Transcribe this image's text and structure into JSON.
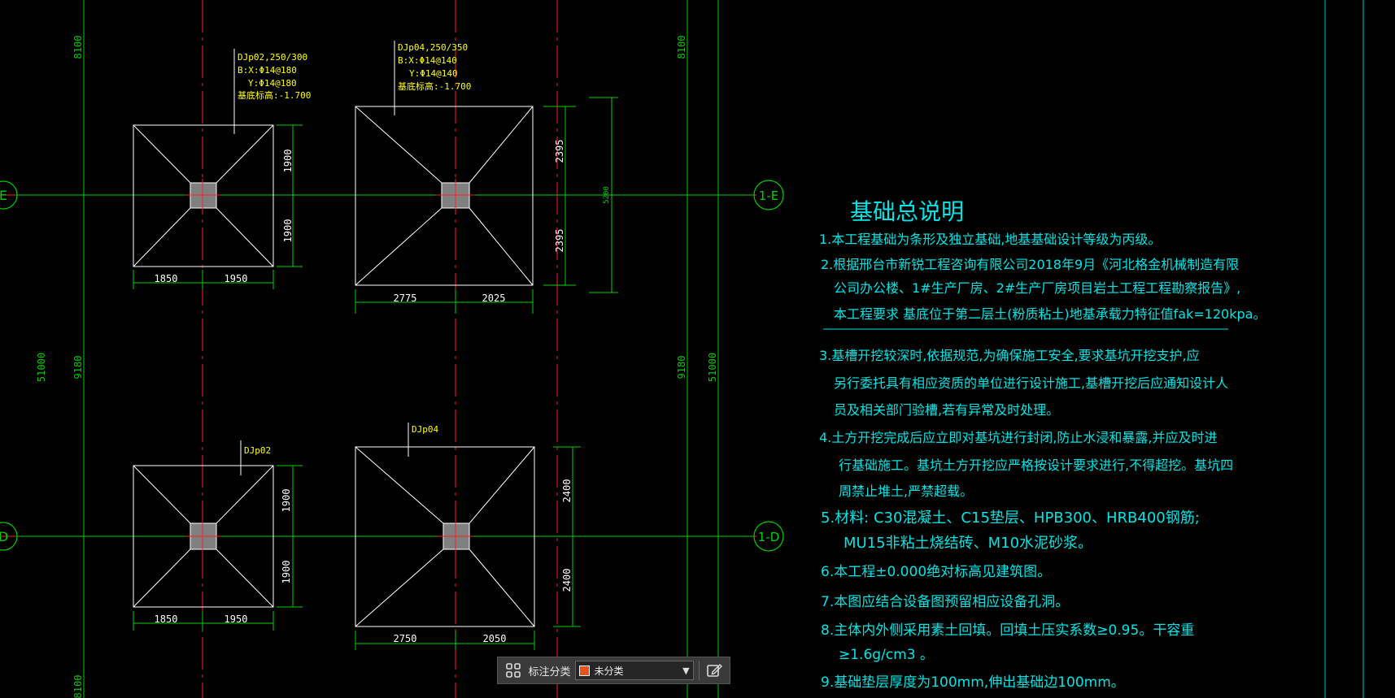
{
  "colors": {
    "background": "#000000",
    "axis": "#ff2020",
    "grid": "#00d000",
    "dim": "#00d000",
    "outline": "#ffffff",
    "label": "#ffff00",
    "note": "#00e5e5",
    "column": "#808080"
  },
  "grid_labels": {
    "e_left": "E",
    "e_right": "1-E",
    "d_left": "D",
    "d_right": "1-D"
  },
  "vertical_dims": {
    "left_top": "8100",
    "left_mid": "9180",
    "left_total": "51000",
    "left_bottom": "8100",
    "right_top": "8100",
    "right_mid": "9180",
    "right_total": "51000"
  },
  "footings": {
    "f1": {
      "label_lines": [
        "DJp02,250/300",
        "B:X:Φ14@180",
        "Y:Φ14@180",
        "基底标高:-1.700"
      ],
      "dim_left": "1850",
      "dim_right": "1950",
      "dim_top": "1900",
      "dim_bottom": "1900"
    },
    "f2": {
      "label_lines": [
        "DJp04,250/350",
        "B:X:Φ14@140",
        "Y:Φ14@140",
        "基底标高:-1.700"
      ],
      "dim_left": "2775",
      "dim_right": "2025",
      "dim_top": "2395",
      "dim_bottom": "2395",
      "dim_total": "5200"
    },
    "f3": {
      "label_lines": [
        "DJp02"
      ],
      "dim_left": "1850",
      "dim_right": "1950",
      "dim_top": "1900",
      "dim_bottom": "1900"
    },
    "f4": {
      "label_lines": [
        "DJp04"
      ],
      "dim_left": "2750",
      "dim_right": "2050",
      "dim_top": "2400",
      "dim_bottom": "2400"
    }
  },
  "notes": {
    "title": "基础总说明",
    "lines": [
      "1.本工程基础为条形及独立基础,地基基础设计等级为丙级。",
      "2.根据邢台市新锐工程咨询有限公司2018年9月《河北格金机械制造有限",
      "公司办公楼、1#生产厂房、2#生产厂房项目岩土工程工程勘察报告》,",
      "本工程要求    基底位于第二层土(粉质粘土)地基承载力特征值fak=120kpa。",
      "3.基槽开挖较深时,依据规范,为确保施工安全,要求基坑开挖支护,应",
      "另行委托具有相应资质的单位进行设计施工,基槽开挖后应通知设计人",
      "员及相关部门验槽,若有异常及时处理。",
      "4.土方开挖完成后应立即对基坑进行封闭,防止水浸和暴露,并应及时进",
      "行基础施工。基坑土方开挖应严格按设计要求进行,不得超挖。基坑四",
      "周禁止堆土,严禁超载。",
      "5.材料: C30混凝土、C15垫层、HPB300、HRB400钢筋;",
      "MU15非粘土烧结砖、M10水泥砂浆。",
      "6.本工程±0.000绝对标高见建筑图。",
      "7.本图应结合设备图预留相应设备孔洞。",
      "8.主体内外侧采用素土回填。回填土压实系数≥0.95。干容重",
      "≥1.6g/cm3  。",
      "9.基础垫层厚度为100mm,伸出基础边100mm。"
    ]
  },
  "toolbar": {
    "grid_icon": "four-squares-icon",
    "label": "标注分类",
    "select_value": "未分类",
    "edit_icon": "edit-icon"
  }
}
